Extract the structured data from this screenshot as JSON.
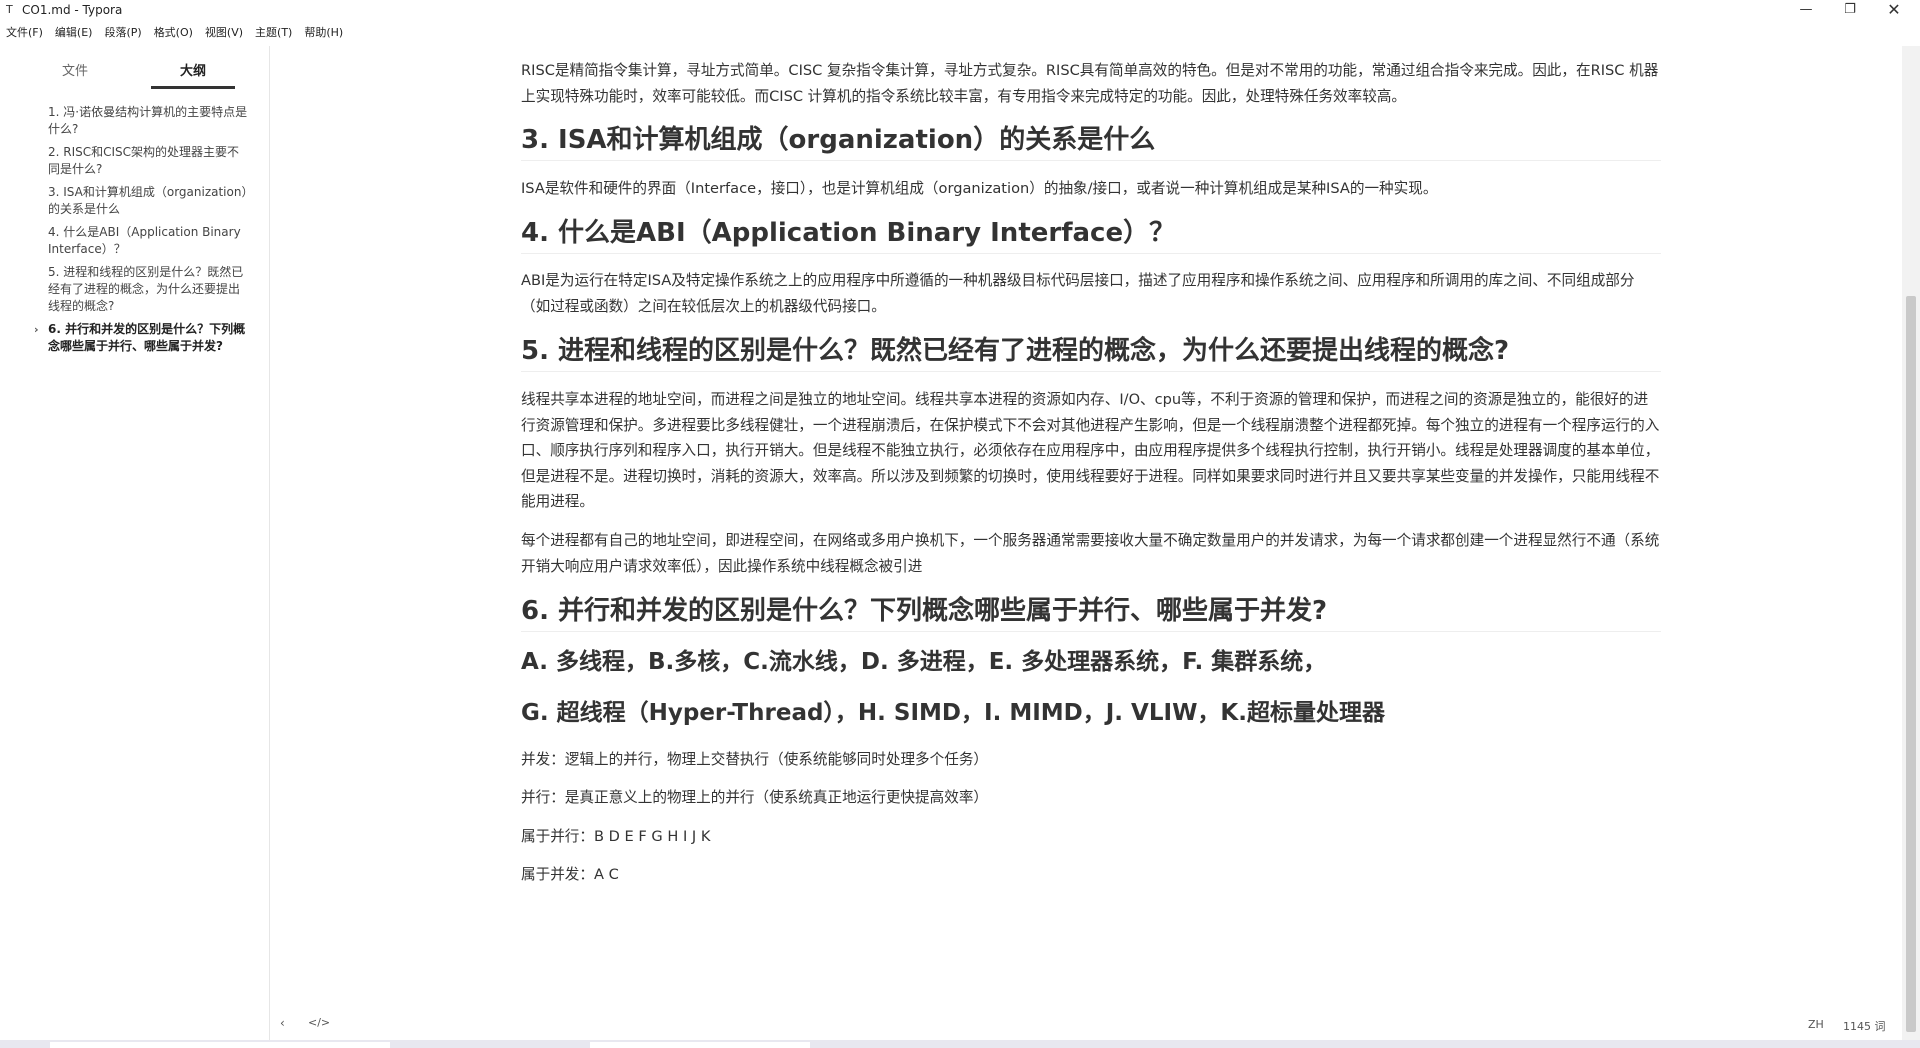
{
  "window": {
    "app_icon": "T",
    "title": "CO1.md - Typora",
    "minimize_icon": "minimize-icon",
    "maximize_icon": "maximize-icon",
    "close_icon": "close-icon"
  },
  "menu": [
    "文件(F)",
    "编辑(E)",
    "段落(P)",
    "格式(O)",
    "视图(V)",
    "主题(T)",
    "帮助(H)"
  ],
  "sidebar": {
    "tabs": {
      "files": "文件",
      "outline": "大纲"
    },
    "active_tab": "outline",
    "items": [
      {
        "label": "1. 冯·诺依曼结构计算机的主要特点是什么?"
      },
      {
        "label": "2. RISC和CISC架构的处理器主要不同是什么?"
      },
      {
        "label": "3. ISA和计算机组成（organization）的关系是什么"
      },
      {
        "label": "4. 什么是ABI（Application Binary Interface）？"
      },
      {
        "label": "5. 进程和线程的区别是什么？既然已经有了进程的概念，为什么还要提出线程的概念?"
      },
      {
        "label": "6. 并行和并发的区别是什么？下列概念哪些属于并行、哪些属于并发?"
      }
    ],
    "active_item": 5,
    "caret": "›"
  },
  "doc": {
    "p_risc": "RISC是精简指令集计算，寻址方式简单。CISC 复杂指令集计算，寻址方式复杂。RISC具有简单高效的特色。但是对不常用的功能，常通过组合指令来完成。因此，在RISC 机器上实现特殊功能时，效率可能较低。而CISC 计算机的指令系统比较丰富，有专用指令来完成特定的功能。因此，处理特殊任务效率较高。",
    "h3": "3. ISA和计算机组成（organization）的关系是什么",
    "p_isa": "ISA是软件和硬件的界面（Interface，接口），也是计算机组成（organization）的抽象/接口，或者说一种计算机组成是某种ISA的一种实现。",
    "h4": "4. 什么是ABI（Application Binary Interface）？",
    "p_abi": "ABI是为运行在特定ISA及特定操作系统之上的应用程序中所遵循的一种机器级目标代码层接口，描述了应用程序和操作系统之间、应用程序和所调用的库之间、不同组成部分（如过程或函数）之间在较低层次上的机器级代码接口。",
    "h5": "5. 进程和线程的区别是什么？既然已经有了进程的概念，为什么还要提出线程的概念?",
    "p_thread1": "线程共享本进程的地址空间，而进程之间是独立的地址空间。线程共享本进程的资源如内存、I/O、cpu等，不利于资源的管理和保护，而进程之间的资源是独立的，能很好的进行资源管理和保护。多进程要比多线程健壮，一个进程崩溃后，在保护模式下不会对其他进程产生影响，但是一个线程崩溃整个进程都死掉。每个独立的进程有一个程序运行的入口、顺序执行序列和程序入口，执行开销大。但是线程不能独立执行，必须依存在应用程序中，由应用程序提供多个线程执行控制，执行开销小。线程是处理器调度的基本单位，但是进程不是。进程切换时，消耗的资源大，效率高。所以涉及到频繁的切换时，使用线程要好于进程。同样如果要求同时进行并且又要共享某些变量的并发操作，只能用线程不能用进程。",
    "p_thread2": "每个进程都有自己的地址空间，即进程空间，在网络或多用户换机下，一个服务器通常需要接收大量不确定数量用户的并发请求，为每一个请求都创建一个进程显然行不通（系统开销大响应用户请求效率低），因此操作系统中线程概念被引进",
    "h6": "6. 并行和并发的区别是什么？下列概念哪些属于并行、哪些属于并发?",
    "h_opts1": "A. 多线程，B.多核，C.流水线，D. 多进程，E. 多处理器系统，F. 集群系统，",
    "h_opts2": "G. 超线程（Hyper-Thread），H. SIMD，I. MIMD，J. VLIW，K.超标量处理器",
    "p_concurrent": "并发：逻辑上的并行，物理上交替执行（使系统能够同时处理多个任务）",
    "p_parallel": "并行：是真正意义上的物理上的并行（使系统真正地运行更快提高效率）",
    "p_parallel_items": "属于并行：B D E F G H I J K",
    "p_concurrent_items": "属于并发：A C"
  },
  "status": {
    "back_icon": "‹",
    "code_icon": "</>",
    "lang": "ZH",
    "words": "1145 词"
  }
}
